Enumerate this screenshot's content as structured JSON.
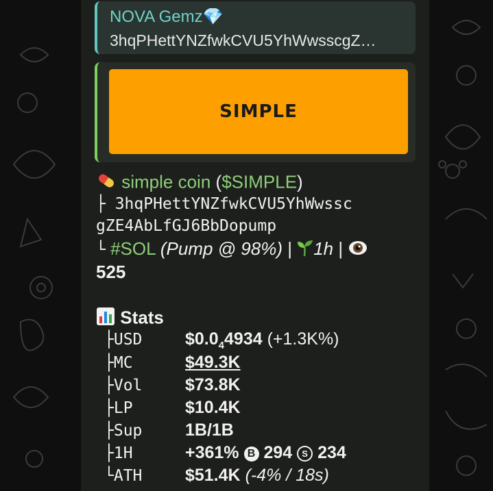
{
  "reply": {
    "title": "NOVA Gemz💎",
    "subtitle": "3hqPHettYNZfwkCVU5YhWwsscgZ…"
  },
  "media": {
    "image_text": "SIMPLE",
    "background_color": "#fe9f00"
  },
  "coin": {
    "icon": "pill-icon",
    "name": "simple coin",
    "ticker_open": "(",
    "ticker": "$SIMPLE",
    "ticker_close": ")",
    "address_line1": "├ 3hqPHettYNZfwkCVU5YhWwssc",
    "address_line2": "gZE4AbLfGJ6BbDopump",
    "tree_end": "└",
    "chain_tag": "#SOL",
    "platform": "(Pump @ 98%)",
    "sep1": "|",
    "age_icon": "seedling-icon",
    "age": "1h",
    "sep2": "|",
    "views_icon": "eye-icon",
    "views": "525"
  },
  "stats": {
    "icon": "bar-chart-icon",
    "title": "Stats",
    "rows": [
      {
        "prefix": "├",
        "key": "USD",
        "value_main": "$0.0",
        "value_sub": "4",
        "value_rest": "4934",
        "value_extra": "(+1.3K%)"
      },
      {
        "prefix": "├",
        "key": "MC",
        "value": "$49.3K"
      },
      {
        "prefix": "├",
        "key": "Vol",
        "value": "$73.8K"
      },
      {
        "prefix": "├",
        "key": "LP",
        "value": "$10.4K"
      },
      {
        "prefix": "├",
        "key": "Sup",
        "value": "1B/1B"
      },
      {
        "prefix": "├",
        "key": "1H",
        "value": "+361%",
        "buy_badge": "B",
        "buys": "294",
        "sell_badge": "S",
        "sells": "234"
      },
      {
        "prefix": "└",
        "key": "ATH",
        "value": "$51.4K",
        "value_extra": "(-4% / 18s)"
      }
    ]
  },
  "colors": {
    "bubble": "#1d1f1c",
    "accent_teal": "#6fd3ca",
    "accent_green": "#8fce7a",
    "text": "#f1f1f1"
  }
}
